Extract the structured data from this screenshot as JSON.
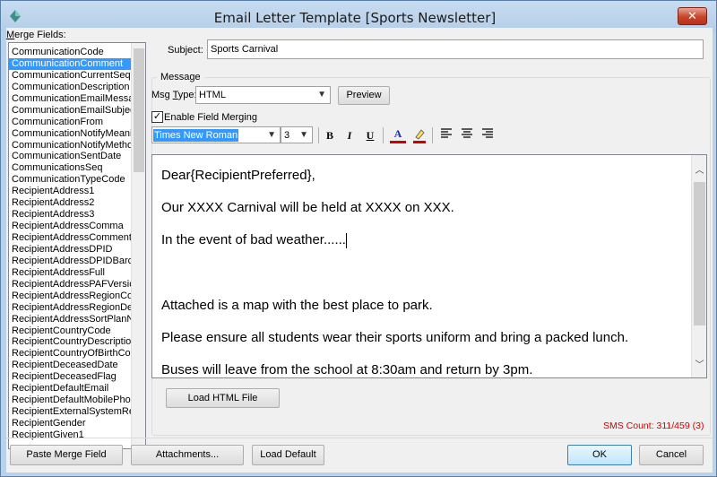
{
  "window": {
    "title": "Email Letter Template [Sports Newsletter]",
    "close_glyph": "✕"
  },
  "merge_fields": {
    "label_underline": "M",
    "label_rest": "erge Fields:",
    "selected_index": 1,
    "items": [
      "CommunicationCode",
      "CommunicationComment",
      "CommunicationCurrentSeq",
      "CommunicationDescription",
      "CommunicationEmailMessag",
      "CommunicationEmailSubject",
      "CommunicationFrom",
      "CommunicationNotifyMeanin",
      "CommunicationNotifyMetho",
      "CommunicationSentDate",
      "CommunicationsSeq",
      "CommunicationTypeCode",
      "RecipientAddress1",
      "RecipientAddress2",
      "RecipientAddress3",
      "RecipientAddressComma",
      "RecipientAddressComment",
      "RecipientAddressDPID",
      "RecipientAddressDPIDBarco",
      "RecipientAddressFull",
      "RecipientAddressPAFVersio",
      "RecipientAddressRegionCoc",
      "RecipientAddressRegionDes",
      "RecipientAddressSortPlanN",
      "RecipientCountryCode",
      "RecipientCountryDescription",
      "RecipientCountryOfBirthCo",
      "RecipientDeceasedDate",
      "RecipientDeceasedFlag",
      "RecipientDefaultEmail",
      "RecipientDefaultMobilePhor",
      "RecipientExternalSystemRe",
      "RecipientGender",
      "RecipientGiven1"
    ]
  },
  "subject": {
    "label": "Subject:",
    "value": "Sports Carnival"
  },
  "message": {
    "group_title": "Message",
    "msg_type_label_pre": "Msg ",
    "msg_type_label_underline": "T",
    "msg_type_label_post": "ype:",
    "msg_type_value": "HTML",
    "preview_label": "Preview",
    "enable_merging_label": "Enable Field Merging",
    "enable_merging_checked": true,
    "font_name": "Times New Roman",
    "font_size": "3"
  },
  "toolbar": {
    "bold": "B",
    "italic": "I",
    "underline": "U",
    "font_color": "A",
    "highlight_color": "#d00000"
  },
  "editor": {
    "paragraphs": [
      "Dear{RecipientPreferred},",
      "Our XXXX Carnival will be held at XXXX on XXX.",
      "In the event of bad weather......",
      "",
      "Attached is a map with the best place to park.",
      "Please ensure all students wear their sports uniform and bring a packed lunch.",
      "Buses will leave from the school at 8:30am and return by 3pm."
    ]
  },
  "load_html_label": "Load HTML File",
  "sms_count": "SMS Count: 311/459 (3)",
  "buttons": {
    "paste_merge": "Paste Merge Field",
    "attachments": "Attachments...",
    "load_default": "Load Default",
    "ok": "OK",
    "cancel": "Cancel"
  }
}
